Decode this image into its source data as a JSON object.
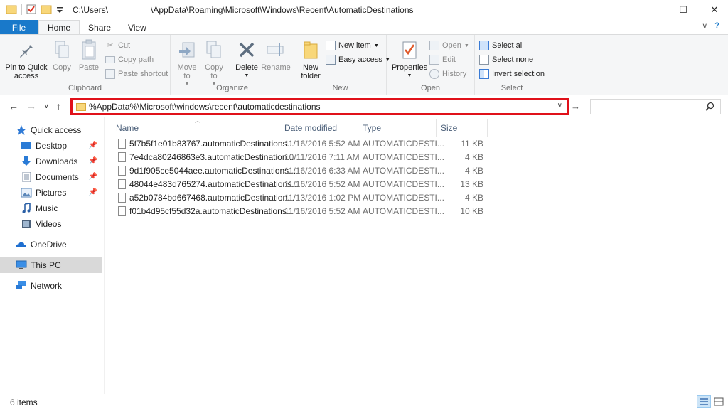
{
  "window": {
    "title": "C:\\Users\\                  \\AppData\\Roaming\\Microsoft\\Windows\\Recent\\AutomaticDestinations",
    "minimize": "—",
    "maximize": "☐",
    "close": "✕"
  },
  "ribbon_tabs": [
    "File",
    "Home",
    "Share",
    "View"
  ],
  "ribbon_right": {
    "expand": "∨",
    "help": "?"
  },
  "ribbon": {
    "clipboard": {
      "label": "Clipboard",
      "pin": "Pin to Quick access",
      "copy": "Copy",
      "paste": "Paste",
      "cut": "Cut",
      "copy_path": "Copy path",
      "paste_shortcut": "Paste shortcut"
    },
    "organize": {
      "label": "Organize",
      "move_to": "Move to",
      "copy_to": "Copy to",
      "delete": "Delete",
      "rename": "Rename"
    },
    "new": {
      "label": "New",
      "new_folder": "New folder",
      "new_item": "New item",
      "easy_access": "Easy access"
    },
    "open": {
      "label": "Open",
      "properties": "Properties",
      "open": "Open",
      "edit": "Edit",
      "history": "History"
    },
    "select": {
      "label": "Select",
      "select_all": "Select all",
      "select_none": "Select none",
      "invert": "Invert selection"
    }
  },
  "address": {
    "value": "%AppData%\\Microsoft\\windows\\recent\\automaticdestinations"
  },
  "nav_pane": {
    "quick_access": "Quick access",
    "items": [
      {
        "label": "Desktop",
        "pinned": true
      },
      {
        "label": "Downloads",
        "pinned": true
      },
      {
        "label": "Documents",
        "pinned": true
      },
      {
        "label": "Pictures",
        "pinned": true
      },
      {
        "label": "Music",
        "pinned": false
      },
      {
        "label": "Videos",
        "pinned": false
      }
    ],
    "onedrive": "OneDrive",
    "this_pc": "This PC",
    "network": "Network"
  },
  "columns": {
    "name": "Name",
    "date_modified": "Date modified",
    "type": "Type",
    "size": "Size"
  },
  "files": [
    {
      "name": "5f7b5f1e01b83767.automaticDestinations...",
      "date": "11/16/2016 5:52 AM",
      "type": "AUTOMATICDESTI...",
      "size": "11 KB"
    },
    {
      "name": "7e4dca80246863e3.automaticDestination...",
      "date": "10/11/2016 7:11 AM",
      "type": "AUTOMATICDESTI...",
      "size": "4 KB"
    },
    {
      "name": "9d1f905ce5044aee.automaticDestinations...",
      "date": "11/16/2016 6:33 AM",
      "type": "AUTOMATICDESTI...",
      "size": "4 KB"
    },
    {
      "name": "48044e483d765274.automaticDestinations...",
      "date": "11/16/2016 5:52 AM",
      "type": "AUTOMATICDESTI...",
      "size": "13 KB"
    },
    {
      "name": "a52b0784bd667468.automaticDestination...",
      "date": "11/13/2016 1:02 PM",
      "type": "AUTOMATICDESTI...",
      "size": "4 KB"
    },
    {
      "name": "f01b4d95cf55d32a.automaticDestinations...",
      "date": "11/16/2016 5:52 AM",
      "type": "AUTOMATICDESTI...",
      "size": "10 KB"
    }
  ],
  "status": {
    "count": "6 items"
  },
  "colors": {
    "file_tab": "#1979ca",
    "highlight_border": "#e0111a",
    "selected_nav": "#d9d9d9"
  }
}
